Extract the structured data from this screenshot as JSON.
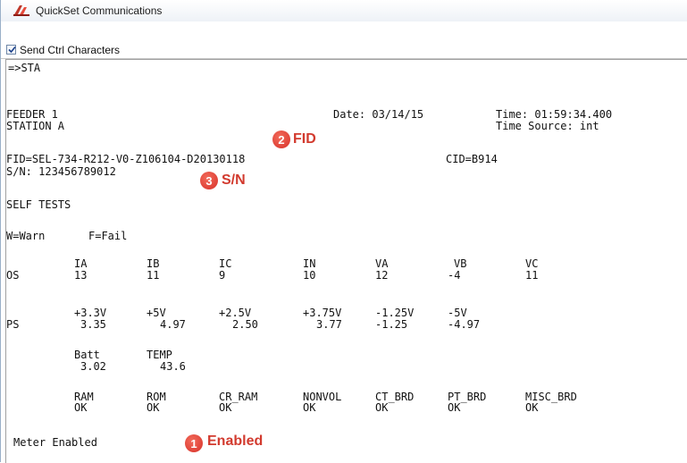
{
  "window": {
    "title": "QuickSet Communications"
  },
  "options": {
    "send_ctrl_characters": {
      "label": "Send Ctrl Characters",
      "checked": true
    }
  },
  "terminal": {
    "prompt": "=>STA",
    "header": {
      "feeder": "FEEDER 1",
      "station": "STATION A",
      "date": "Date: 03/14/15",
      "time": "Time: 01:59:34.400",
      "time_source": "Time Source: int"
    },
    "fid": "FID=SEL-734-R212-V0-Z106104-D20130118",
    "cid": "CID=B914",
    "sn": "S/N: 123456789012",
    "self_tests": "SELF TESTS",
    "legend": {
      "warn": "W=Warn",
      "fail": "F=Fail"
    },
    "os": {
      "row_label": "OS",
      "headers": [
        "IA",
        "IB",
        "IC",
        "IN",
        "VA",
        "VB",
        "VC"
      ],
      "values": [
        "13",
        "11",
        "9",
        "10",
        "12",
        "-4",
        "11"
      ]
    },
    "ps": {
      "row_label": "PS",
      "headers": [
        "+3.3V",
        "+5V",
        "+2.5V",
        "+3.75V",
        "-1.25V",
        "-5V"
      ],
      "values": [
        "3.35",
        "4.97",
        "2.50",
        "3.77",
        "-1.25",
        "-4.97"
      ]
    },
    "batt_temp": {
      "headers": [
        "Batt",
        "TEMP"
      ],
      "values": [
        "3.02",
        "43.6"
      ]
    },
    "status": {
      "headers": [
        "RAM",
        "ROM",
        "CR_RAM",
        "NONVOL",
        "CT_BRD",
        "PT_BRD",
        "MISC_BRD"
      ],
      "values": [
        "OK",
        "OK",
        "OK",
        "OK",
        "OK",
        "OK",
        "OK"
      ]
    },
    "meter": "Meter Enabled"
  },
  "annotations": [
    {
      "number": "1",
      "label": "Enabled"
    },
    {
      "number": "2",
      "label": "FID"
    },
    {
      "number": "3",
      "label": "S/N"
    }
  ],
  "colors": {
    "callout": "#d23a2e",
    "badge": "#d8322a"
  }
}
